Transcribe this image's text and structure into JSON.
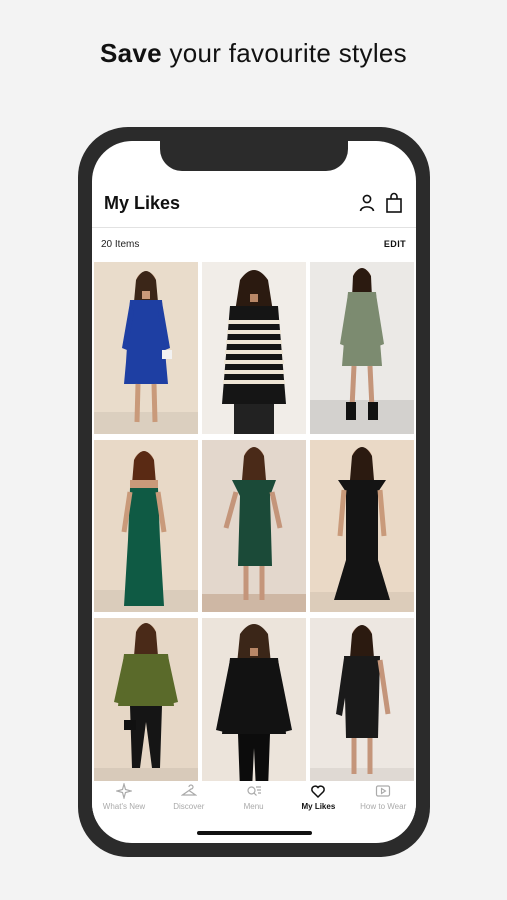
{
  "promo": {
    "headline_bold": "Save",
    "headline_rest": "your favourite styles"
  },
  "header": {
    "title": "My Likes"
  },
  "subbar": {
    "count": "20 Items",
    "edit_label": "EDIT"
  },
  "products": [
    {
      "outfit": "blue wrap mini dress",
      "bg": "#e9dccb",
      "color": "#1e3fa3"
    },
    {
      "outfit": "black and cream striped jumper",
      "bg": "#f1ede8",
      "color": "#151515"
    },
    {
      "outfit": "green printed mini dress",
      "bg": "#ebe9e6",
      "color": "#7c8b70"
    },
    {
      "outfit": "emerald bandeau maxi dress",
      "bg": "#e8d9c7",
      "color": "#0f5a44"
    },
    {
      "outfit": "green bardot midi dress",
      "bg": "#e3d7cc",
      "color": "#1b4a38"
    },
    {
      "outfit": "black bardot fishtail maxi dress",
      "bg": "#ead9c6",
      "color": "#141414"
    },
    {
      "outfit": "khaki satin blouse",
      "bg": "#e6d7c6",
      "color": "#5a6a2a"
    },
    {
      "outfit": "black tie front blouse",
      "bg": "#ece4db",
      "color": "#121212"
    },
    {
      "outfit": "black sequin one shoulder dress",
      "bg": "#ede7e1",
      "color": "#1a1a1a"
    }
  ],
  "tabs": [
    {
      "label": "What's New",
      "icon": "sparkle-icon",
      "active": false
    },
    {
      "label": "Discover",
      "icon": "hanger-icon",
      "active": false
    },
    {
      "label": "Menu",
      "icon": "search-menu-icon",
      "active": false
    },
    {
      "label": "My Likes",
      "icon": "heart-icon",
      "active": true
    },
    {
      "label": "How to Wear",
      "icon": "play-icon",
      "active": false
    }
  ]
}
